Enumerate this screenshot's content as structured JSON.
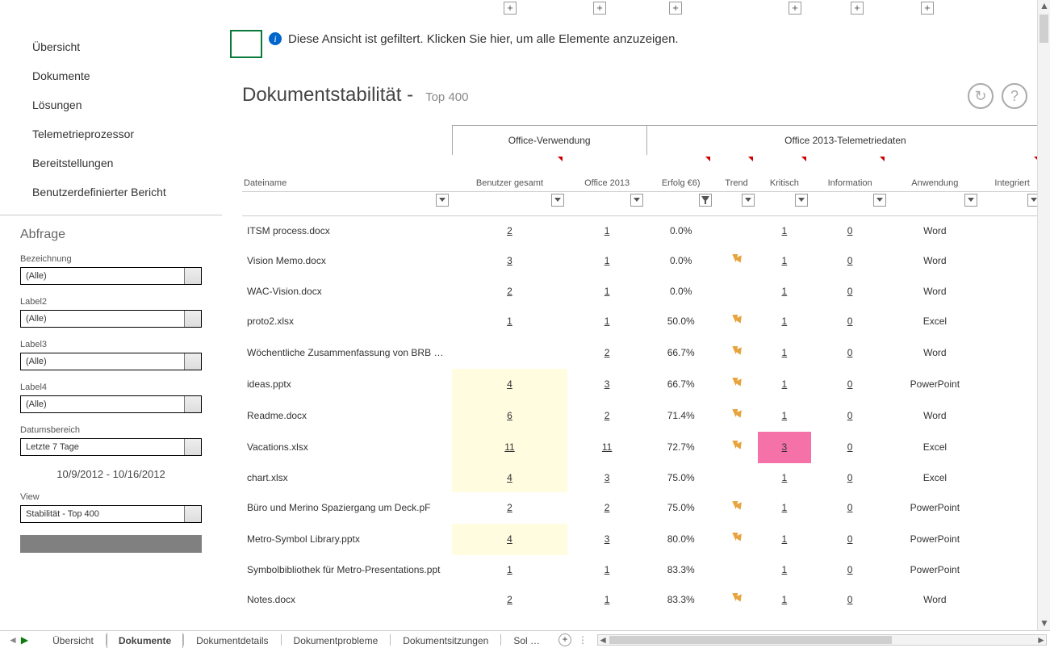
{
  "plus_positions": [
    624,
    735,
    829,
    977,
    1054,
    1141
  ],
  "nav": {
    "items": [
      {
        "label": "Übersicht"
      },
      {
        "label": "Dokumente"
      },
      {
        "label": "Lösungen"
      },
      {
        "label": "Telemetrieprozessor"
      },
      {
        "label": "Bereitstellungen"
      },
      {
        "label": "Benutzerdefinierter Bericht"
      }
    ]
  },
  "query": {
    "title": "Abfrage",
    "fields": [
      {
        "label": "Bezeichnung",
        "value": "(Alle)"
      },
      {
        "label": "Label2",
        "value": "(Alle)"
      },
      {
        "label": "Label3",
        "value": "(Alle)"
      },
      {
        "label": "Label4",
        "value": "(Alle)"
      },
      {
        "label": "Datumsbereich",
        "value": "Letzte 7 Tage"
      }
    ],
    "date_range": "10/9/2012 - 10/16/2012",
    "view_label": "View",
    "view_value": "Stabilität - Top 400"
  },
  "banner": "Diese Ansicht ist gefiltert. Klicken Sie hier, um alle Elemente anzuzeigen.",
  "title": "Dokumentstabilität -",
  "subtitle": "Top 400",
  "columns": {
    "file": "Dateiname",
    "group_usage": "Office-Verwendung",
    "group_tele": "Office 2013-Telemetriedaten",
    "users_total": "Benutzer gesamt",
    "office2013": "Office 2013",
    "success": "Erfolg €6)",
    "trend": "Trend",
    "critical": "Kritisch",
    "info": "Information",
    "app": "Anwendung",
    "integrated": "Integriert"
  },
  "rows": [
    {
      "file": "ITSM process.docx",
      "users": "2",
      "o2013": "1",
      "success": "0.0%",
      "trend": false,
      "crit": "1",
      "info": "0",
      "app": "Word"
    },
    {
      "file": "Vision Memo.docx",
      "users": "3",
      "o2013": "1",
      "success": "0.0%",
      "trend": true,
      "crit": "1",
      "info": "0",
      "app": "Word"
    },
    {
      "file": "WAC-Vision.docx",
      "users": "2",
      "o2013": "1",
      "success": "0.0%",
      "trend": false,
      "crit": "1",
      "info": "0",
      "app": "Word"
    },
    {
      "file": "proto2.xlsx",
      "users": "1",
      "o2013": "1",
      "success": "50.0%",
      "trend": true,
      "crit": "1",
      "info": "0",
      "app": "Excel"
    },
    {
      "file": "Wöchentliche Zusammenfassung von BRB Feedback senden -",
      "users": "",
      "o2013": "2",
      "success": "66.7%",
      "trend": true,
      "crit": "1",
      "info": "0",
      "app": "Word"
    },
    {
      "file": "ideas.pptx",
      "users": "4",
      "o2013": "3",
      "success": "66.7%",
      "trend": true,
      "crit": "1",
      "info": "0",
      "app": "PowerPoint",
      "hl_users": true
    },
    {
      "file": "Readme.docx",
      "users": "6",
      "o2013": "2",
      "success": "71.4%",
      "trend": true,
      "crit": "1",
      "info": "0",
      "app": "Word",
      "hl_users": true
    },
    {
      "file": "Vacations.xlsx",
      "users": "11",
      "o2013": "11",
      "success": "72.7%",
      "trend": true,
      "crit": "3",
      "info": "0",
      "app": "Excel",
      "hl_users": true,
      "hl_crit": true
    },
    {
      "file": "chart.xlsx",
      "users": "4",
      "o2013": "3",
      "success": "75.0%",
      "trend": false,
      "crit": "1",
      "info": "0",
      "app": "Excel",
      "hl_users": true
    },
    {
      "file": "Büro und Merino Spaziergang um Deck.pF",
      "users": "2",
      "o2013": "2",
      "success": "75.0%",
      "trend": true,
      "crit": "1",
      "info": "0",
      "app": "PowerPoint"
    },
    {
      "file": "Metro-Symbol Library.pptx",
      "users": "4",
      "o2013": "3",
      "success": "80.0%",
      "trend": true,
      "crit": "1",
      "info": "0",
      "app": "PowerPoint",
      "hl_users": true
    },
    {
      "file": "Symbolbibliothek für Metro-Presentations.ppt",
      "users": "1",
      "o2013": "1",
      "success": "83.3%",
      "trend": false,
      "crit": "1",
      "info": "0",
      "app": "PowerPoint"
    },
    {
      "file": "Notes.docx",
      "users": "2",
      "o2013": "1",
      "success": "83.3%",
      "trend": true,
      "crit": "1",
      "info": "0",
      "app": "Word"
    }
  ],
  "tabs": {
    "items": [
      {
        "label": "Übersicht",
        "active": false
      },
      {
        "label": "Dokumente",
        "active": true
      },
      {
        "label": "Dokumentdetails",
        "active": false
      },
      {
        "label": "Dokumentprobleme",
        "active": false
      },
      {
        "label": "Dokumentsitzungen",
        "active": false
      },
      {
        "label": "Sol …",
        "active": false
      }
    ]
  }
}
